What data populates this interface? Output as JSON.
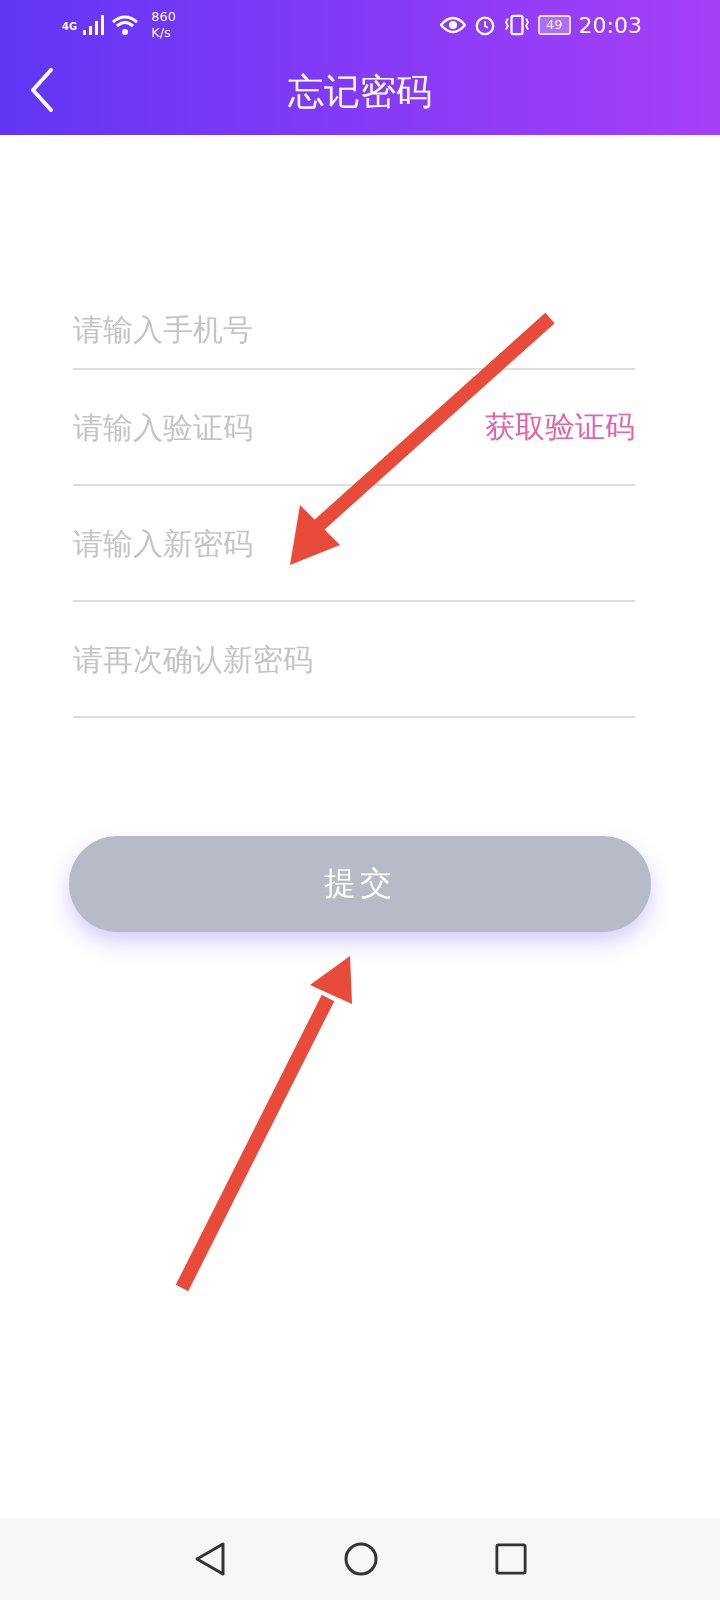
{
  "status_bar": {
    "network": "4G",
    "speed": "860",
    "speed_unit": "K/s",
    "battery": "49",
    "time": "20:03"
  },
  "header": {
    "title": "忘记密码"
  },
  "fields": [
    {
      "placeholder": "请输入手机号"
    },
    {
      "placeholder": "请输入验证码",
      "action": "获取验证码"
    },
    {
      "placeholder": "请输入新密码"
    },
    {
      "placeholder": "请再次确认新密码"
    }
  ],
  "submit": {
    "label": "提交",
    "disabled": true
  }
}
